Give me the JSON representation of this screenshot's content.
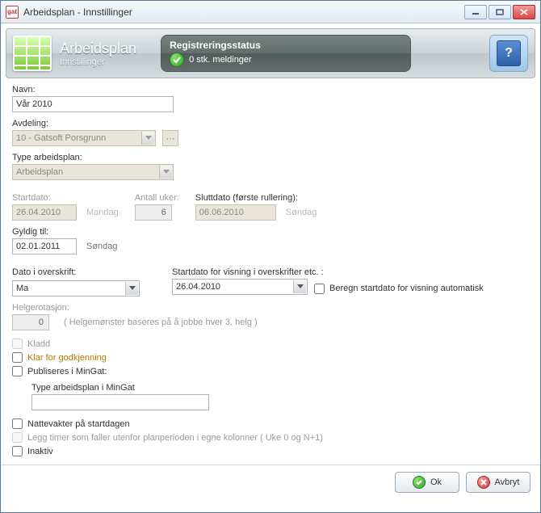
{
  "window": {
    "title": "Arbeidsplan - Innstillinger"
  },
  "header": {
    "title": "Arbeidsplan",
    "subtitle": "Innstillinger"
  },
  "status": {
    "title": "Registreringsstatus",
    "message": "0 stk. meldinger"
  },
  "labels": {
    "navn": "Navn:",
    "avdeling": "Avdeling:",
    "type_arbeidsplan": "Type arbeidsplan:",
    "startdato": "Startdato:",
    "antall_uker": "Antall uker:",
    "sluttdato": "Sluttdato (første rullering):",
    "gyldig_til": "Gyldig til:",
    "dato_i_overskrift": "Dato i overskrift:",
    "startdato_visning": "Startdato for visning i overskrifter etc. :",
    "helgerotasjon": "Helgerotasjon:",
    "type_mingat": "Type arbeidsplan i MinGat"
  },
  "values": {
    "navn": "Vår 2010",
    "avdeling": "10 - Gatsoft Porsgrunn",
    "type_arbeidsplan": "Arbeidsplan",
    "startdato": "26.04.2010",
    "startdag": "Mandag",
    "antall_uker": "6",
    "sluttdato": "06.06.2010",
    "sluttdag": "Søndag",
    "gyldig_til": "02.01.2011",
    "gyldig_dag": "Søndag",
    "dato_i_overskrift": "Ma",
    "startdato_visning": "26.04.2010",
    "helgerotasjon": "0",
    "helge_hint": "( Helgemønster baseres på å jobbe hver 3. helg )",
    "type_mingat": ""
  },
  "checkboxes": {
    "beregn_auto": "Beregn startdato for visning automatisk",
    "kladd": "Kladd",
    "klar_godkjenning": "Klar for godkjenning",
    "publiseres_mingat": "Publiseres i MinGat:",
    "nattevakter": "Nattevakter på startdagen",
    "legg_timer": "Legg timer som faller utenfor planperioden i egne kolonner ( Uke 0 og N+1)",
    "inaktiv": "Inaktiv"
  },
  "buttons": {
    "ok": "Ok",
    "avbryt": "Avbryt"
  }
}
